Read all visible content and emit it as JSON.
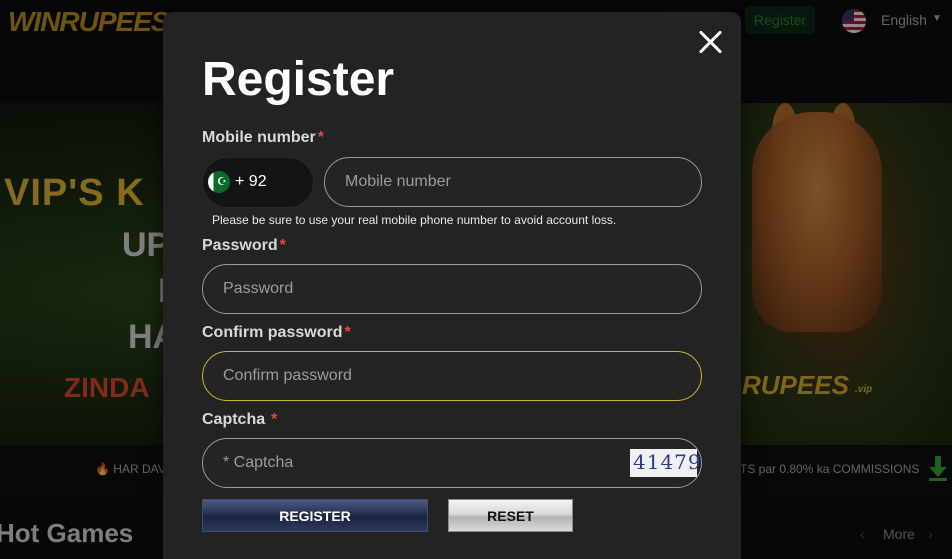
{
  "header": {
    "logo_text": "WINRUPEES",
    "register_label": "Register",
    "language_label": "English"
  },
  "banner": {
    "line1": "VIP'S K",
    "line2": "UP",
    "line3": "I",
    "line4": "HA",
    "line5": "ZINDA",
    "logo_text": "RUPEES",
    "logo_suffix": ".vip"
  },
  "marquee": {
    "left_text": "🔥 HAR DAV",
    "right_text": "TS par 0.80% ka COMMISSIONS"
  },
  "section": {
    "title": "Hot Games",
    "more_label": "More"
  },
  "modal": {
    "title": "Register",
    "mobile": {
      "label": "Mobile number",
      "country_code": "+ 92",
      "placeholder": "Mobile number",
      "value": "",
      "hint": "Please be sure to use your real mobile phone number to avoid account loss."
    },
    "password": {
      "label": "Password",
      "placeholder": "Password",
      "value": ""
    },
    "confirm_password": {
      "label": "Confirm password",
      "placeholder": "Confirm password",
      "value": ""
    },
    "captcha": {
      "label": "Captcha",
      "placeholder": "* Captcha",
      "value": "",
      "image_text": "41479"
    },
    "required_mark": "*",
    "register_button": "REGISTER",
    "reset_button": "RESET"
  },
  "colors": {
    "modal_bg": "#232323",
    "required": "#e24b3b",
    "focus_border": "#c9b62a",
    "brand_gold": "#c99a1c"
  },
  "icons": {
    "close": "close-icon",
    "country_flag": "pakistan-flag-icon",
    "language_flag": "us-flag-icon",
    "download": "download-icon"
  }
}
